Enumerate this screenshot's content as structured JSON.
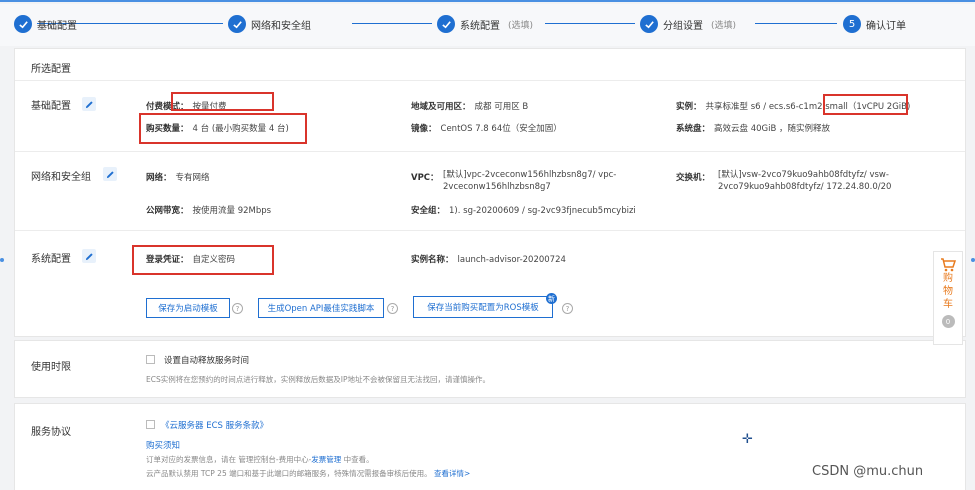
{
  "steps": [
    {
      "label": "基础配置",
      "sub": "",
      "done": true
    },
    {
      "label": "网络和安全组",
      "sub": "",
      "done": true
    },
    {
      "label": "系统配置",
      "sub": "(选填)",
      "done": true
    },
    {
      "label": "分组设置",
      "sub": "(选填)",
      "done": true
    },
    {
      "label": "确认订单",
      "sub": "",
      "number": "5"
    }
  ],
  "summary": {
    "title": "所选配置",
    "basic": {
      "title": "基础配置",
      "billing_label": "付费模式：",
      "billing_value": "按量付费",
      "region_label": "地域及可用区：",
      "region_value": "成都 可用区 B",
      "instance_label": "实例：",
      "instance_value": "共享标准型 s6 / ecs.s6-c1m2.small（1vCPU 2GiB)",
      "quantity_label": "购买数量：",
      "quantity_value": "4 台 (最小购买数量 4 台)",
      "image_label": "镜像：",
      "image_value": "CentOS 7.8 64位（安全加固）",
      "disk_label": "系统盘：",
      "disk_value": "高效云盘 40GiB ，随实例释放"
    },
    "network": {
      "title": "网络和安全组",
      "net_label": "网络：",
      "net_value": "专有网络",
      "vpc_label": "VPC：",
      "vpc_value_1": "[默认]vpc-2vceconw156hlhzbsn8g7/ vpc-",
      "vpc_value_2": "2vceconw156hlhzbsn8g7",
      "vswitch_label": "交换机：",
      "vswitch_value_1": "[默认]vsw-2vco79kuo9ahb08fdtyfz/ vsw-",
      "vswitch_value_2": "2vco79kuo9ahb08fdtyfz/ 172.24.80.0/20",
      "bandwidth_label": "公网带宽：",
      "bandwidth_value": "按使用流量 92Mbps",
      "sg_label": "安全组：",
      "sg_value": "1). sg-20200609 / sg-2vc93fjnecub5mcybizi"
    },
    "system": {
      "title": "系统配置",
      "cred_label": "登录凭证：",
      "cred_value": "自定义密码",
      "name_label": "实例名称：",
      "name_value": "launch-advisor-20200724"
    },
    "actions": {
      "save_template": "保存为启动模板",
      "gen_api": "生成Open API最佳实践脚本",
      "save_ros": "保存当前购买配置为ROS模板",
      "help_glyph": "?",
      "ros_badge": "新"
    }
  },
  "usage": {
    "title": "使用时限",
    "auto_release_label": "设置自动释放服务时间",
    "note": "ECS实例将在您预约的时间点进行释放，实例释放后数据及IP地址不会被保留且无法找回，请谨慎操作。"
  },
  "agreement": {
    "title": "服务协议",
    "terms_link": "《云服务器 ECS 服务条款》",
    "notice_link": "购买须知",
    "notice_text_1": "订单对应的发票信息，请在 管理控制台-费用中心-",
    "notice_link_2": "发票管理",
    "notice_text_2": " 中查看。",
    "port_text": "云产品默认禁用 TCP 25 端口和基于此端口的邮箱服务，特殊情况需报备审核后使用。",
    "port_link": "查看详情>"
  },
  "cart": {
    "chars": [
      "购",
      "物",
      "车"
    ],
    "count": "0"
  },
  "watermark": "CSDN @mu.chun",
  "colors": {
    "accent": "#1f6fd1",
    "highlight": "#d9342b",
    "cart": "#e87b1f"
  }
}
